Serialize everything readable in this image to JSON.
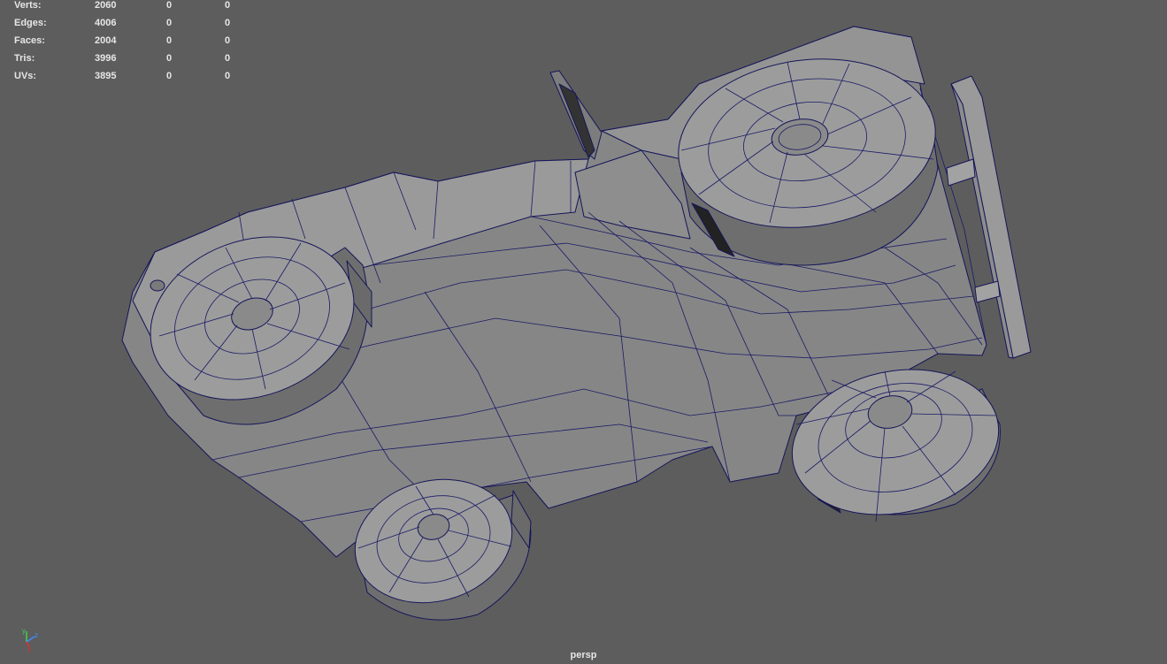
{
  "heads_up_display": {
    "rows": [
      {
        "label": "Verts:",
        "total": "2060",
        "selected": "0",
        "component": "0"
      },
      {
        "label": "Edges:",
        "total": "4006",
        "selected": "0",
        "component": "0"
      },
      {
        "label": "Faces:",
        "total": "2004",
        "selected": "0",
        "component": "0"
      },
      {
        "label": "Tris:",
        "total": "3996",
        "selected": "0",
        "component": "0"
      },
      {
        "label": "UVs:",
        "total": "3895",
        "selected": "0",
        "component": "0"
      }
    ]
  },
  "viewport": {
    "camera_name": "persp",
    "background_color": "#5d5d5d",
    "wireframe_color": "#15155a",
    "mesh_color": "#8a8a8a"
  },
  "axis_gizmo": {
    "x": "x",
    "y": "y",
    "z": "z"
  }
}
